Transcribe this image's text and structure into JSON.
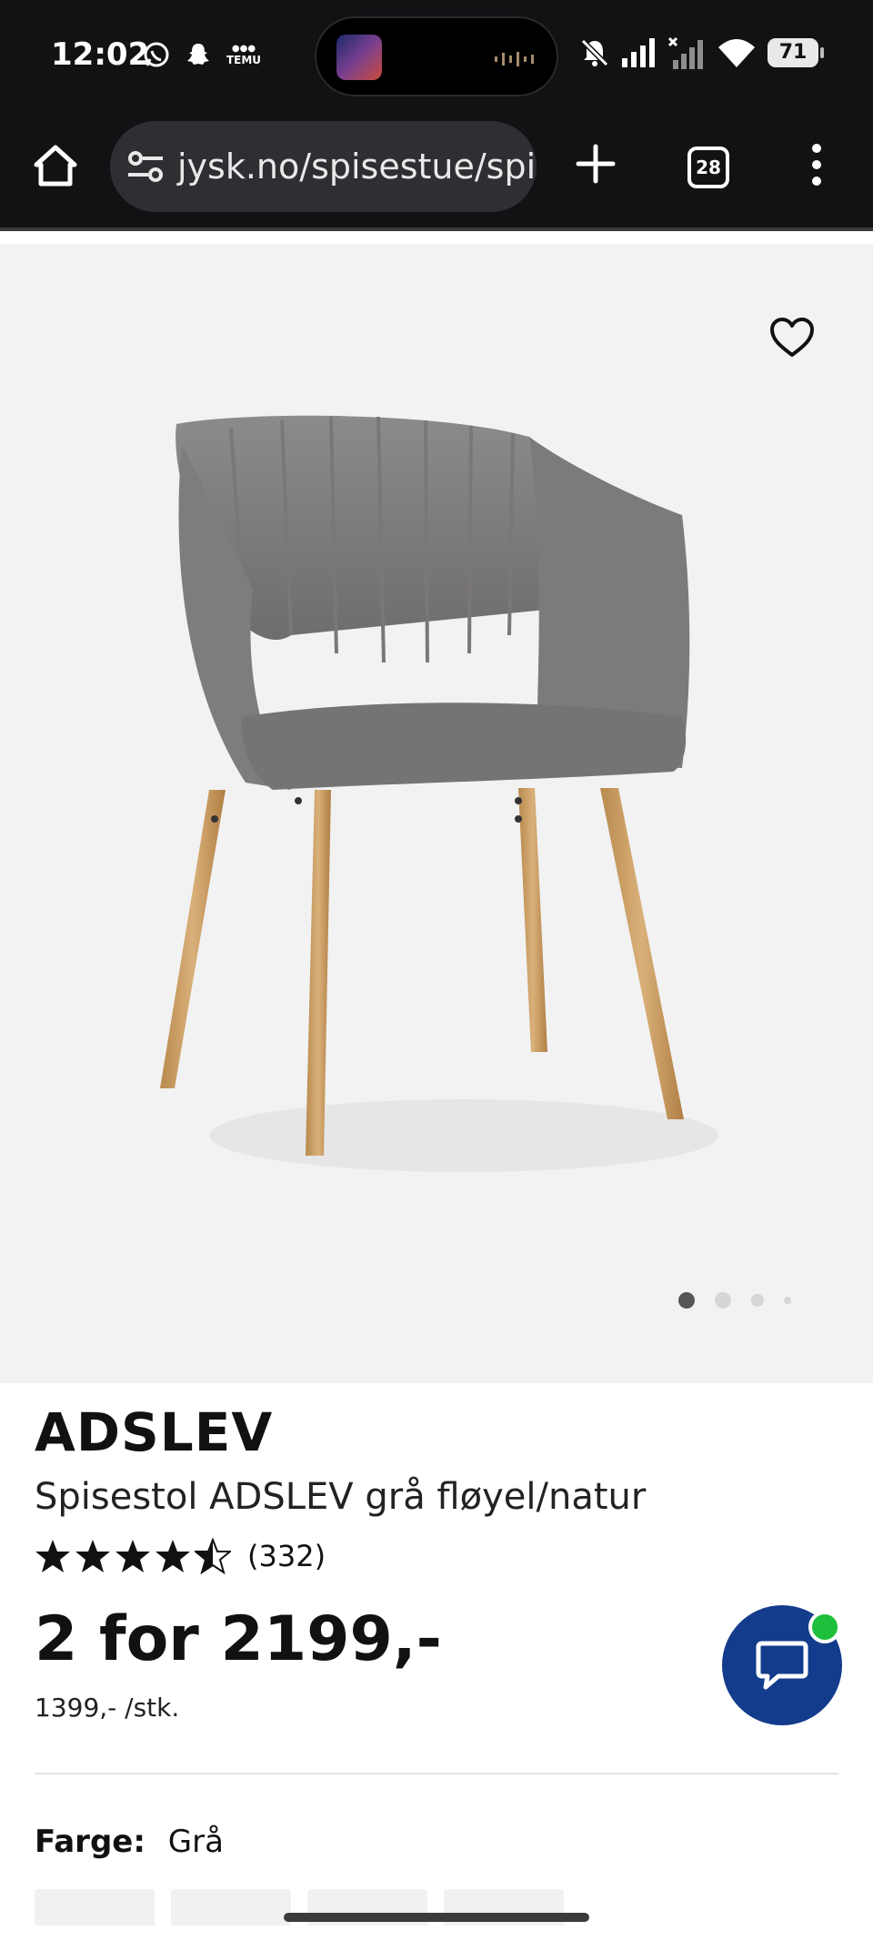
{
  "status_bar": {
    "time": "12:02",
    "left_icons": [
      "whatsapp-icon",
      "snapchat-icon",
      "temu-icon"
    ],
    "temu_label": "TEMU",
    "battery_level": "71",
    "right_icons": [
      "mute-icon",
      "signal-icon",
      "signal-icon-2",
      "wifi-icon",
      "battery-icon"
    ]
  },
  "browser": {
    "url": "jysk.no/spisestue/spi",
    "tab_count": "28"
  },
  "gallery": {
    "active_index": 0,
    "image_count": 4
  },
  "product": {
    "name": "ADSLEV",
    "description": "Spisestol ADSLEV grå fløyel/natur",
    "rating": 4.5,
    "rating_count": "(332)",
    "price": "2 for 2199,-",
    "unit_price": "1399,- /stk.",
    "color_label": "Farge:",
    "color_value": "Grå"
  },
  "colors": {
    "chat_button": "#143c8c",
    "online_indicator": "#1ebf3a",
    "browser_bar": "#111214"
  }
}
